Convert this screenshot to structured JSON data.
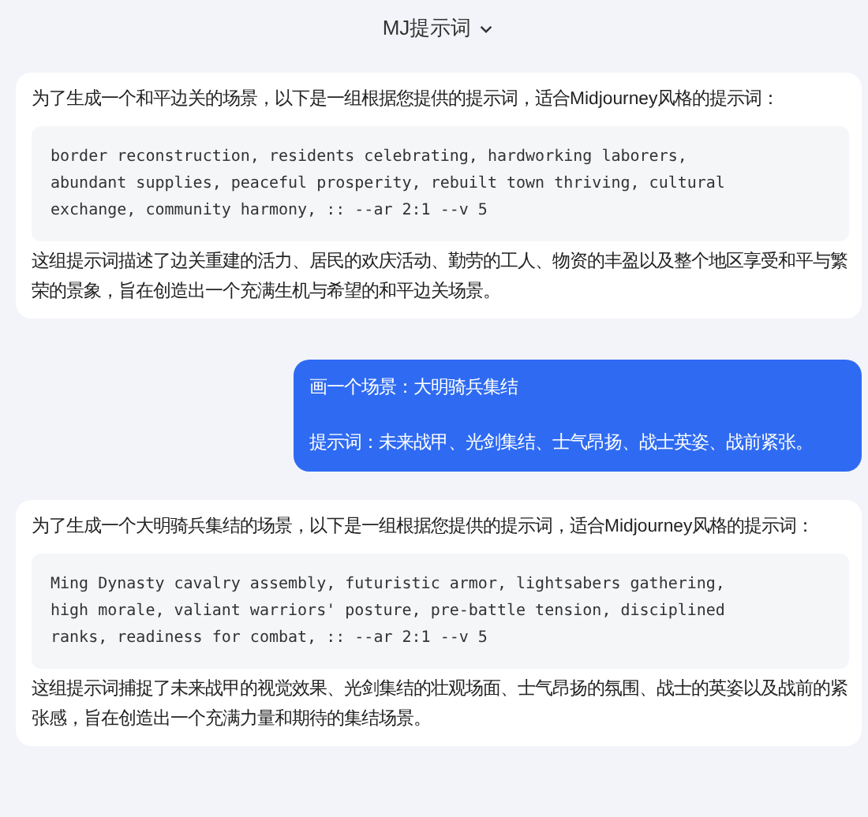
{
  "header": {
    "title": "MJ提示词"
  },
  "messages": [
    {
      "kind": "bot",
      "intro": "为了生成一个和平边关的场景，以下是一组根据您提供的提示词，适合Midjourney风格的提示词：",
      "code": "border reconstruction, residents celebrating, hardworking laborers,\nabundant supplies, peaceful prosperity, rebuilt town thriving, cultural\nexchange, community harmony, :: --ar 2:1 --v 5",
      "outro": "这组提示词描述了边关重建的活力、居民的欢庆活动、勤劳的工人、物资的丰盈以及整个地区享受和平与繁荣的景象，旨在创造出一个充满生机与希望的和平边关场景。"
    },
    {
      "kind": "user",
      "lines": [
        "画一个场景：大明骑兵集结",
        "提示词：未来战甲、光剑集结、士气昂扬、战士英姿、战前紧张。"
      ]
    },
    {
      "kind": "bot",
      "intro": "为了生成一个大明骑兵集结的场景，以下是一组根据您提供的提示词，适合Midjourney风格的提示词：",
      "code": "Ming Dynasty cavalry assembly, futuristic armor, lightsabers gathering,\nhigh morale, valiant warriors' posture, pre-battle tension, disciplined\nranks, readiness for combat, :: --ar 2:1 --v 5",
      "outro": "这组提示词捕捉了未来战甲的视觉效果、光剑集结的壮观场面、士气昂扬的氛围、战士的英姿以及战前的紧张感，旨在创造出一个充满力量和期待的集结场景。"
    }
  ]
}
